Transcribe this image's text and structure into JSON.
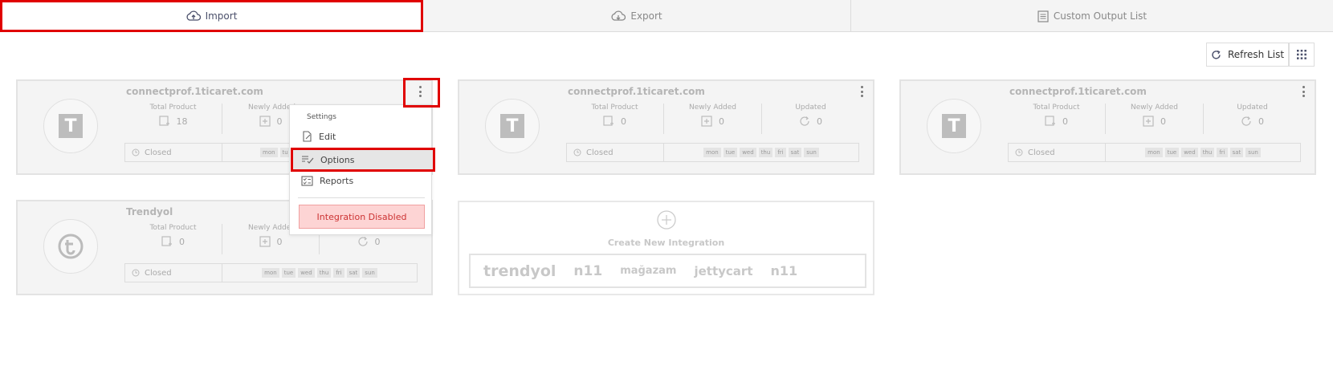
{
  "tabs": [
    {
      "label": "Import",
      "icon": "cloud-upload-icon",
      "active": true
    },
    {
      "label": "Export",
      "icon": "cloud-download-icon",
      "active": false
    },
    {
      "label": "Custom Output List",
      "icon": "list-document-icon",
      "active": false
    }
  ],
  "toolbar": {
    "refresh_label": "Refresh List",
    "grid_icon": "grid-icon"
  },
  "cards": [
    {
      "name": "connectprof.1ticaret.com",
      "logo": "T",
      "total_label": "Total Product",
      "total": "18",
      "new_label": "Newly Added",
      "new": "0",
      "status": "Closed"
    },
    {
      "name": "connectprof.1ticaret.com",
      "logo": "T",
      "total_label": "Total Product",
      "total": "0",
      "new_label": "Newly Added",
      "new": "0",
      "upd_label": "Updated",
      "upd": "0",
      "status": "Closed"
    },
    {
      "name": "connectprof.1ticaret.com",
      "logo": "T",
      "total_label": "Total Product",
      "total": "0",
      "new_label": "Newly Added",
      "new": "0",
      "upd_label": "Updated",
      "upd": "0",
      "status": "Closed"
    },
    {
      "name": "Trendyol",
      "logo": "trendyol-logo",
      "total_label": "Total Product",
      "total": "0",
      "new_label": "Newly Added",
      "new": "0",
      "upd": "0",
      "status": "Closed"
    }
  ],
  "days": [
    "mon",
    "tue",
    "wed",
    "thu",
    "fri",
    "sat",
    "sun"
  ],
  "days_partial": [
    "mon",
    "tu"
  ],
  "menu": {
    "header": "Settings",
    "edit": "Edit",
    "options": "Options",
    "reports": "Reports",
    "disabled": "Integration Disabled"
  },
  "create": {
    "label": "Create New Integration",
    "logos": [
      "trendyol",
      "n11",
      "mağazam",
      "jettycart",
      "n11"
    ],
    "logo_sub": "Trendyol, n11, jettycart"
  },
  "colors": {
    "highlight": "#e00000",
    "disabled_bg": "#fdd4d4",
    "accent": "#4a4f6a"
  }
}
